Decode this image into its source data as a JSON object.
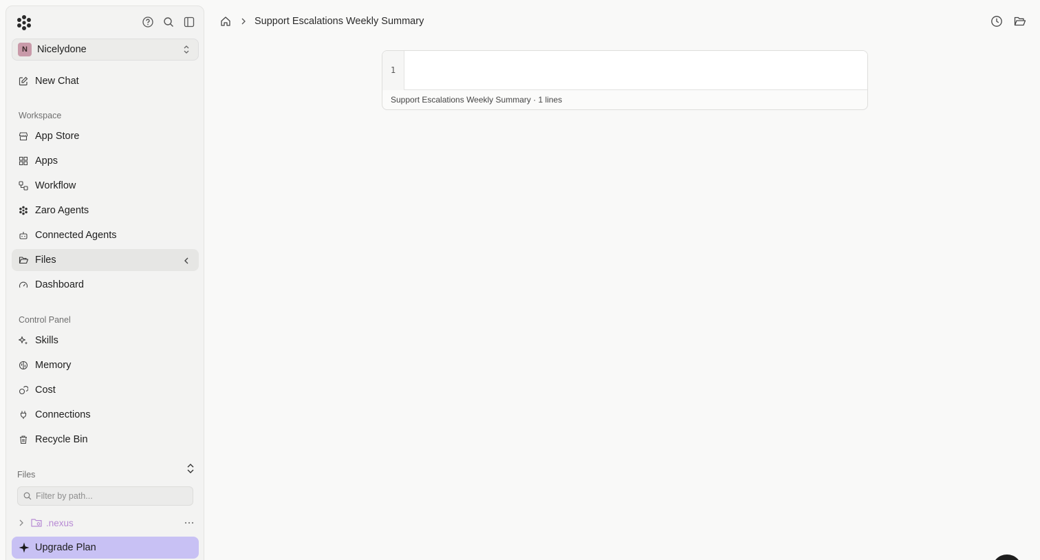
{
  "sidebar": {
    "workspace_switcher": {
      "initial": "N",
      "name": "Nicelydone"
    },
    "new_chat_label": "New Chat",
    "workspace_section_label": "Workspace",
    "workspace_items": [
      {
        "label": "App Store",
        "icon": "store-icon"
      },
      {
        "label": "Apps",
        "icon": "grid-icon"
      },
      {
        "label": "Workflow",
        "icon": "workflow-icon"
      },
      {
        "label": "Zaro Agents",
        "icon": "agents-icon"
      },
      {
        "label": "Connected Agents",
        "icon": "robot-icon"
      },
      {
        "label": "Files",
        "icon": "folder-open-icon",
        "active": true
      },
      {
        "label": "Dashboard",
        "icon": "gauge-icon"
      }
    ],
    "control_section_label": "Control Panel",
    "control_items": [
      {
        "label": "Skills",
        "icon": "sparkles-icon"
      },
      {
        "label": "Memory",
        "icon": "brain-icon"
      },
      {
        "label": "Cost",
        "icon": "coins-icon"
      },
      {
        "label": "Connections",
        "icon": "plug-icon"
      },
      {
        "label": "Recycle Bin",
        "icon": "trash-icon"
      }
    ],
    "files_section_label": "Files",
    "filter_placeholder": "Filter by path...",
    "tree": [
      {
        "label": ".nexus",
        "icon": "folder-settings-icon"
      }
    ],
    "upgrade_label": "Upgrade Plan"
  },
  "header": {
    "breadcrumb_title": "Support Escalations Weekly Summary"
  },
  "editor": {
    "line_numbers": [
      "1"
    ],
    "footer": "Support Escalations Weekly Summary · 1 lines"
  },
  "colors": {
    "accent_upgrade": "#c8c1f4",
    "active_nav": "#e6e6e4",
    "tree_folder": "#b78ad4"
  }
}
